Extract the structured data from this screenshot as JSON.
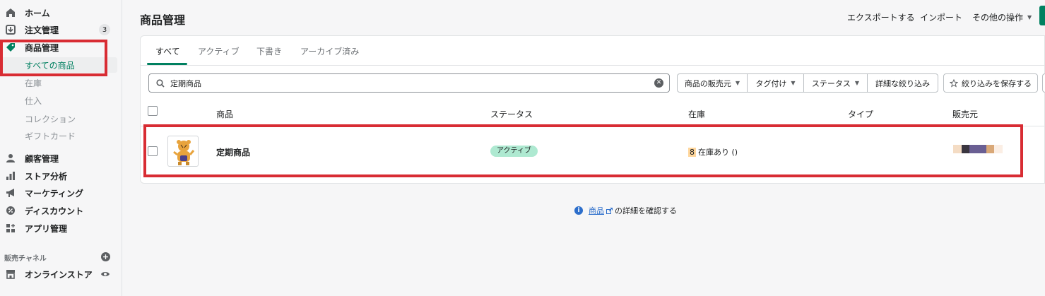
{
  "sidebar": {
    "items": [
      {
        "label": "ホーム",
        "icon": "home-icon"
      },
      {
        "label": "注文管理",
        "icon": "orders-icon",
        "badge": "3"
      },
      {
        "label": "商品管理",
        "icon": "tag-icon"
      },
      {
        "label": "顧客管理",
        "icon": "person-icon"
      },
      {
        "label": "ストア分析",
        "icon": "bar-chart-icon"
      },
      {
        "label": "マーケティング",
        "icon": "megaphone-icon"
      },
      {
        "label": "ディスカウント",
        "icon": "discount-icon"
      },
      {
        "label": "アプリ管理",
        "icon": "apps-icon"
      }
    ],
    "product_sub": [
      "すべての商品",
      "在庫",
      "仕入",
      "コレクション",
      "ギフトカード"
    ],
    "sales_channels_title": "販売チャネル",
    "online_store": "オンラインストア"
  },
  "header": {
    "title": "商品管理",
    "export": "エクスポートする",
    "import": "インポート",
    "more_actions": "その他の操作"
  },
  "tabs": [
    "すべて",
    "アクティブ",
    "下書き",
    "アーカイブ済み"
  ],
  "search": {
    "value": "定期商品"
  },
  "filters": {
    "vendor": "商品の販売元",
    "tagged": "タグ付け",
    "status": "ステータス",
    "more_filters": "詳細な絞り込み",
    "save_filter": "絞り込みを保存する"
  },
  "table": {
    "columns": [
      "商品",
      "ステータス",
      "在庫",
      "タイプ",
      "販売元"
    ],
    "rows": [
      {
        "name": "定期商品",
        "status": "アクティブ",
        "stock_num": "8",
        "stock_text": "在庫あり ()"
      }
    ]
  },
  "footer": {
    "link": "商品",
    "text": "の詳細を確認する"
  },
  "colors": {
    "accent": "#008060",
    "highlight": "#d82c33",
    "status_active": "#aee9d1"
  }
}
